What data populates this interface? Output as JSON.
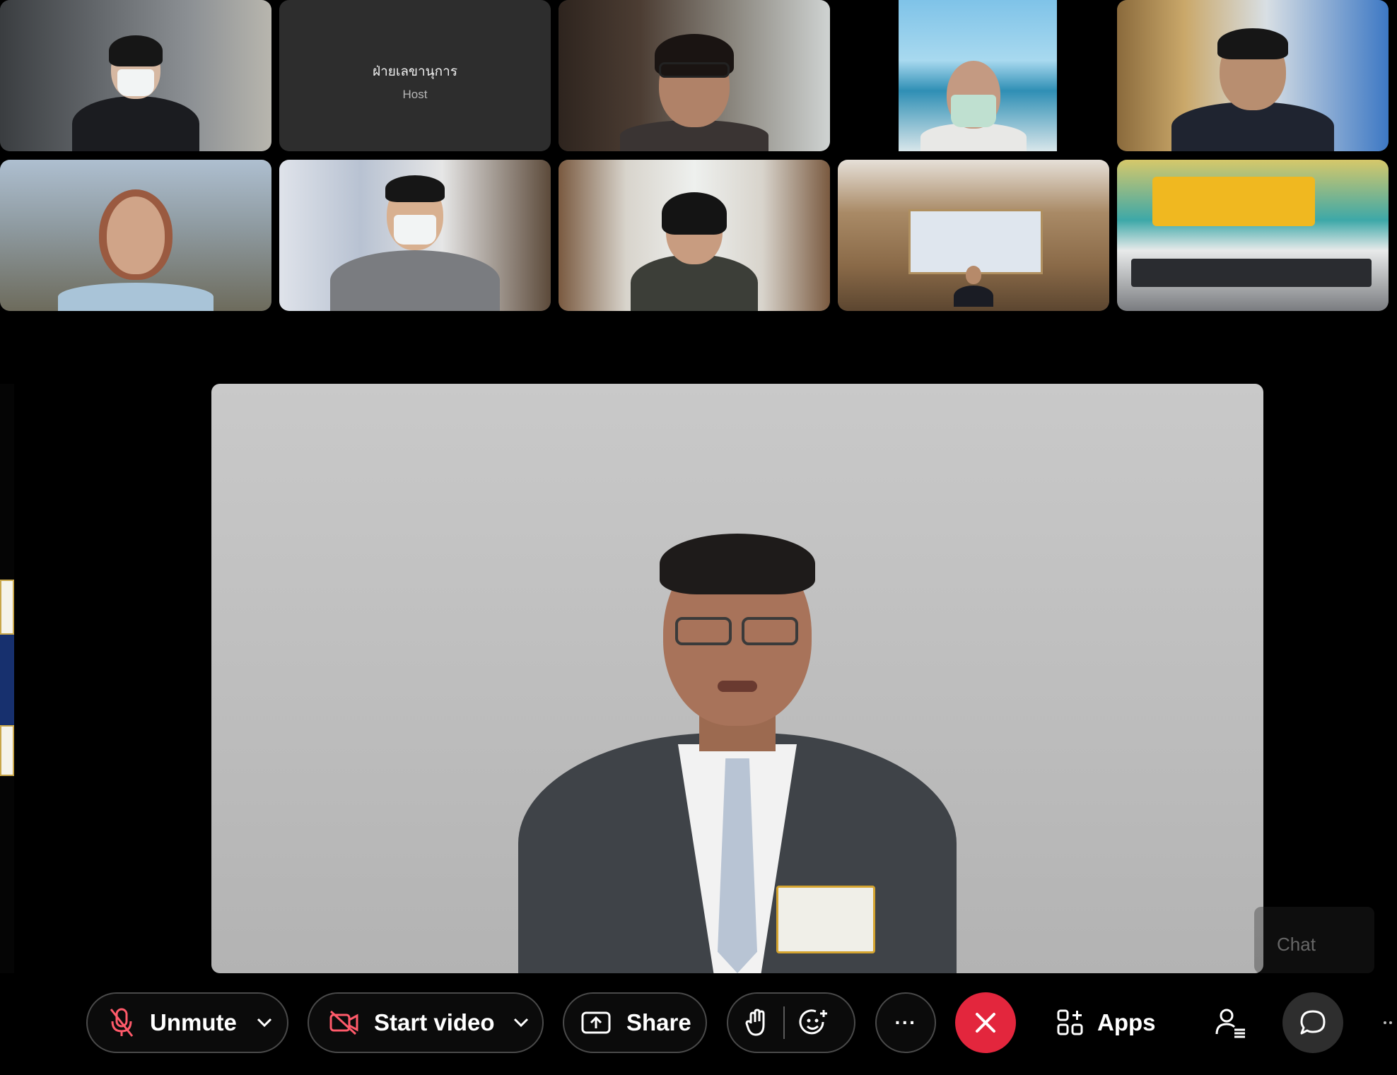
{
  "gallery": {
    "host_tile": {
      "name": "ฝ่ายเลขานุการ",
      "role": "Host"
    },
    "participant_count": 10
  },
  "main_stage": {
    "speaker": "active-speaker-video"
  },
  "chat_panel": {
    "label": "Chat"
  },
  "toolbar": {
    "unmute_label": "Unmute",
    "start_video_label": "Start video",
    "share_label": "Share",
    "more_label": "···",
    "apps_label": "Apps"
  },
  "colors": {
    "background": "#000000",
    "end_call": "#e3263d",
    "button_border": "#4a4a4a",
    "muted_icon": "#ff5a6a"
  },
  "icons": {
    "unmute": "mic-muted-icon",
    "video": "video-off-icon",
    "share": "share-screen-icon",
    "raise_hand": "raise-hand-icon",
    "reactions": "reaction-emoji-icon",
    "end": "close-icon",
    "apps": "apps-grid-icon",
    "participants": "participants-icon",
    "chat": "chat-bubble-icon"
  }
}
